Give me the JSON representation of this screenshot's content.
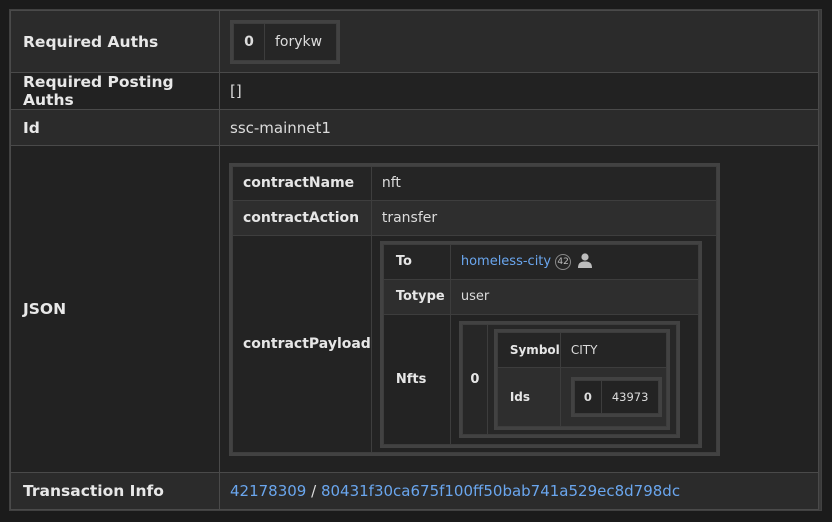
{
  "rows": {
    "required_auths": {
      "label": "Required Auths",
      "items": [
        {
          "index": "0",
          "name": "forykw"
        }
      ]
    },
    "required_posting_auths": {
      "label": "Required Posting Auths",
      "value": "[]"
    },
    "id": {
      "label": "Id",
      "value": "ssc-mainnet1"
    },
    "json": {
      "label": "JSON",
      "contract_name": {
        "key": "contractName",
        "value": "nft"
      },
      "contract_action": {
        "key": "contractAction",
        "value": "transfer"
      },
      "contract_payload": {
        "key": "contractPayload",
        "to": {
          "key": "To",
          "value": "homeless-city",
          "reputation": "42"
        },
        "totype": {
          "key": "Totype",
          "value": "user"
        },
        "nfts": {
          "key": "Nfts",
          "index": "0",
          "symbol": {
            "key": "Symbol",
            "value": "CITY"
          },
          "ids": {
            "key": "Ids",
            "index": "0",
            "value": "43973"
          }
        }
      }
    },
    "transaction_info": {
      "label": "Transaction Info",
      "block": "42178309",
      "separator": " / ",
      "tx_id": "80431f30ca675f100ff50bab741a529ec8d798dc"
    }
  },
  "colors": {
    "link": "#6aa6ee",
    "background": "#1b1b1b",
    "row_odd": "#2b2b2b",
    "row_even": "#222222"
  },
  "icons": {
    "user": "user-icon"
  }
}
